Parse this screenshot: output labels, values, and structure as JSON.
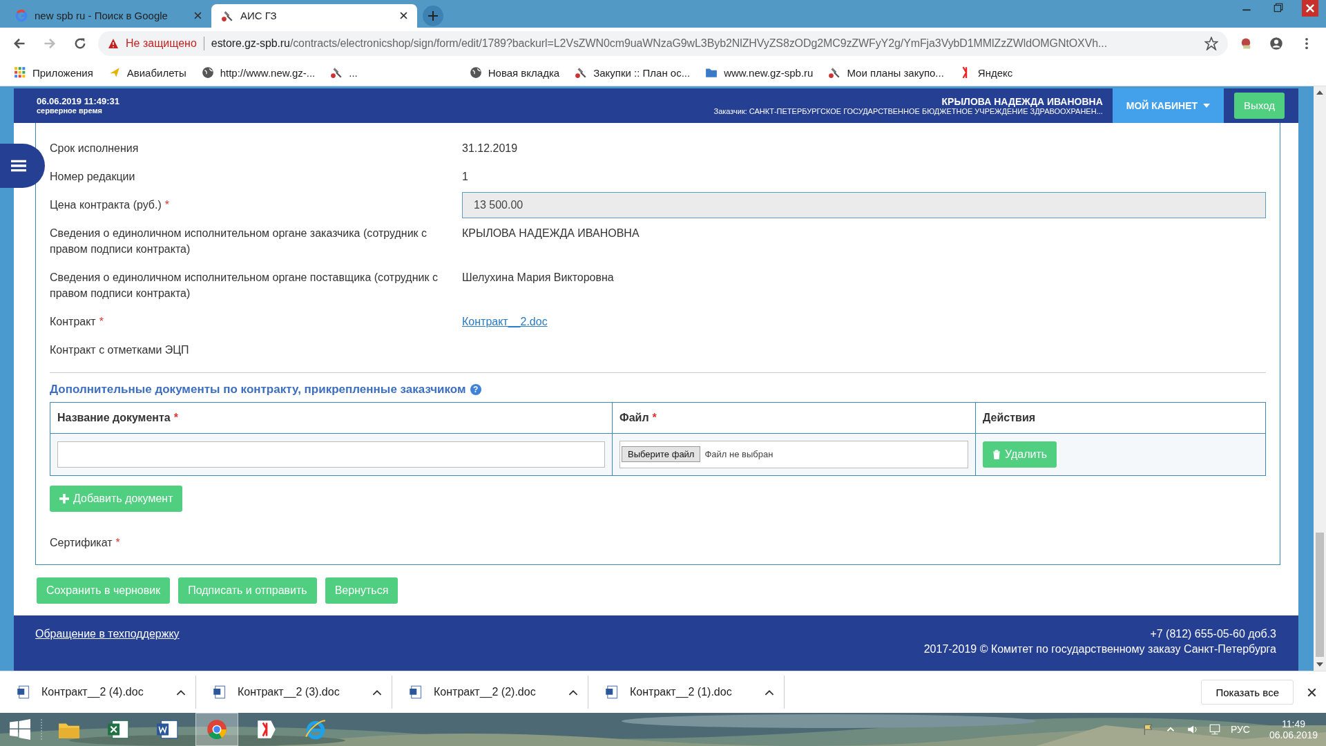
{
  "browser": {
    "tabs": [
      {
        "title": "new spb ru - Поиск в Google",
        "kind": "google",
        "selected": false
      },
      {
        "title": "АИС ГЗ",
        "kind": "hammer",
        "selected": true
      }
    ],
    "security": "Не защищено",
    "url_host": "estore.gz-spb.ru",
    "url_path": "/contracts/electronicshop/sign/form/edit/1789?backurl=L2VsZWN0cm9uaWNzaG9wL3Byb2NlZHVyZS8zODg2MC9zZWFyY2g/YmFja3VybD1MMlZzZWldOMGNtOXVh...",
    "bookmarks": [
      {
        "label": "Приложения",
        "kind": "apps"
      },
      {
        "label": "Авиабилеты",
        "kind": "plane"
      },
      {
        "label": "http://www.new.gz-...",
        "kind": "globe"
      },
      {
        "label": "...",
        "kind": "hammer"
      },
      {
        "label": "Новая вкладка",
        "kind": "globe"
      },
      {
        "label": "Закупки :: План ос...",
        "kind": "hammer"
      },
      {
        "label": "www.new.gz-spb.ru",
        "kind": "folder"
      },
      {
        "label": "Мои планы закупо...",
        "kind": "hammer"
      },
      {
        "label": "Яндекс",
        "kind": "yandex"
      }
    ]
  },
  "header": {
    "datetime": "06.06.2019 11:49:31",
    "datetime_note": "серверное время",
    "user": "КРЫЛОВА НАДЕЖДА ИВАНОВНА",
    "org": "Заказчик: САНКТ-ПЕТЕРБУРГСКОЕ ГОСУДАРСТВЕННОЕ БЮДЖЕТНОЕ УЧРЕЖДЕНИЕ ЗДРАВООХРАНЕН...",
    "cabinet": "МОЙ КАБИНЕТ",
    "logout": "Выход"
  },
  "fields": [
    {
      "label": "Срок исполнения",
      "kind": "text",
      "value": "31.12.2019"
    },
    {
      "label": "Номер редакции",
      "kind": "text",
      "value": "1"
    },
    {
      "label": "Цена контракта (руб.)",
      "required_mark": "*",
      "kind": "input",
      "value": "13 500.00"
    },
    {
      "label": "Сведения о единоличном исполнительном органе заказчика (сотрудник с правом подписи контракта)",
      "kind": "text",
      "value": "КРЫЛОВА НАДЕЖДА ИВАНОВНА"
    },
    {
      "label": "Сведения о единоличном исполнительном органе поставщика (сотрудник с правом подписи контракта)",
      "kind": "text",
      "value": "Шелухина Мария Викторовна"
    },
    {
      "label": "Контракт",
      "required_mark": "*",
      "kind": "link",
      "value": "Контракт__2.doc"
    },
    {
      "label": "Контракт с отметками ЭЦП",
      "kind": "text"
    }
  ],
  "docs": {
    "title": "Дополнительные документы по контракту, прикрепленные заказчиком",
    "help": "?",
    "columns": [
      {
        "label": "Название документа",
        "required_mark": "*"
      },
      {
        "label": "Файл",
        "required_mark": "*"
      },
      {
        "label": "Действия"
      }
    ],
    "rows": [
      {
        "file_button": "Выберите файл",
        "file_status": "Файл не выбран",
        "delete": "Удалить"
      }
    ],
    "add": "Добавить документ"
  },
  "certificate": {
    "label": "Сертификат",
    "required_mark": "*"
  },
  "actions": [
    "Сохранить в черновик",
    "Подписать и отправить",
    "Вернуться"
  ],
  "footer": {
    "support": "Обращение в техподдержку",
    "phone": "+7 (812) 655-05-60 доб.3",
    "copyright": "2017-2019 © Комитет по государственному заказу Санкт-Петербурга"
  },
  "downloads": {
    "items": [
      "Контракт__2 (4).doc",
      "Контракт__2 (3).doc",
      "Контракт__2 (2).doc",
      "Контракт__2 (1).doc"
    ],
    "show_all": "Показать все"
  },
  "taskbar": {
    "apps": [
      {
        "kind": "explorer",
        "selected": false
      },
      {
        "kind": "excel",
        "selected": false
      },
      {
        "kind": "word",
        "selected": false
      },
      {
        "kind": "chrome",
        "selected": true
      },
      {
        "kind": "yandex",
        "selected": false
      },
      {
        "kind": "ie",
        "selected": false
      }
    ],
    "language": "РУС",
    "time": "11:49",
    "date": "06.06.2019"
  }
}
